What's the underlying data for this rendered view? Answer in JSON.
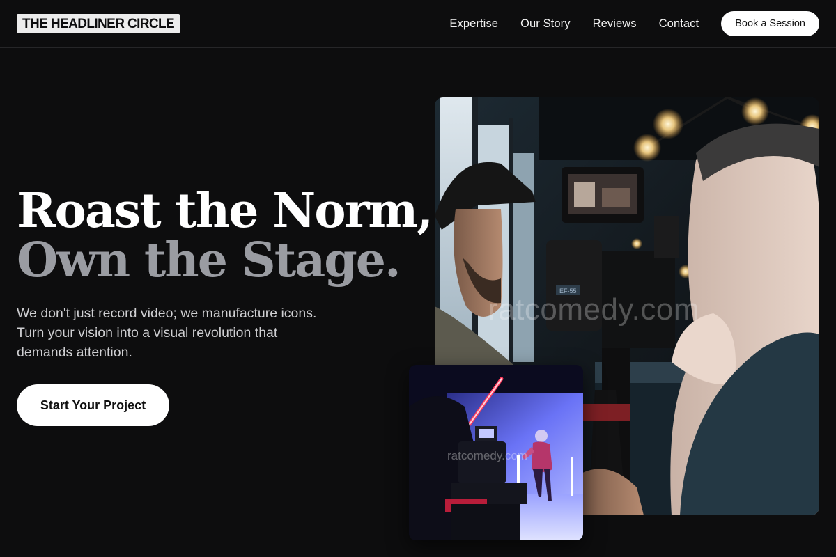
{
  "header": {
    "logo_text": "THE HEADLINER CIRCLE",
    "nav": [
      "Expertise",
      "Our Story",
      "Reviews",
      "Contact"
    ],
    "cta_label": "Book a Session"
  },
  "hero": {
    "headline_line1": "Roast the Norm,",
    "headline_line2": "Own the Stage.",
    "subcopy": "We don't just record video; we manufacture icons. Turn your vision into a visual revolution that demands attention.",
    "cta_label": "Start Your Project"
  },
  "images": {
    "main_watermark": "ratcomedy.com",
    "inset_watermark": "ratcomedy.com",
    "camera_screen_label": "EF-55"
  },
  "colors": {
    "background": "#0d0d0e",
    "headline_primary": "#ffffff",
    "headline_secondary": "#9a9ca2",
    "button_bg": "#ffffff",
    "button_text": "#111111",
    "stage_blue": "#5a63f0",
    "lightsaber_red": "#ff3b5c"
  }
}
